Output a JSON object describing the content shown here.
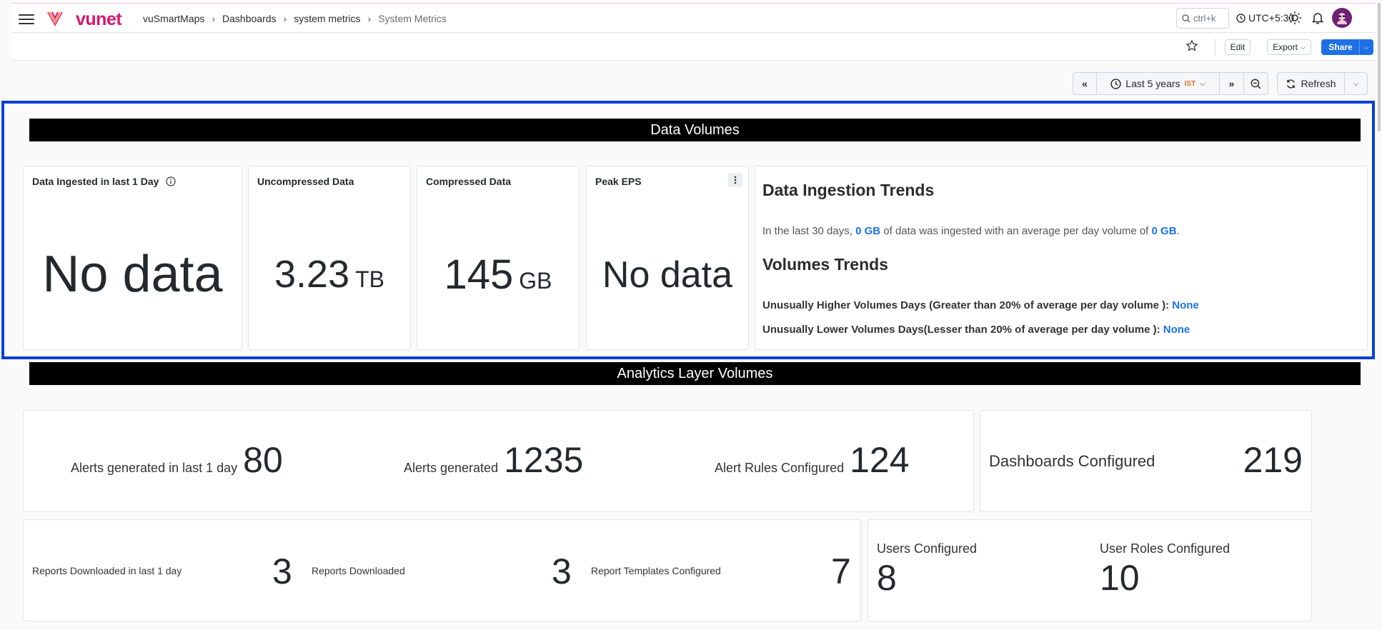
{
  "header": {
    "brand": "vunet",
    "breadcrumbs": [
      "vuSmartMaps",
      "Dashboards",
      "system metrics",
      "System Metrics"
    ],
    "search_label": "ctrl+k",
    "timezone": "UTC+5:30"
  },
  "toolbar": {
    "edit_label": "Edit",
    "export_label": "Export",
    "share_label": "Share"
  },
  "timebar": {
    "range_label": "Last 5 years",
    "tz_badge": "IST",
    "refresh_label": "Refresh"
  },
  "sections": {
    "data_volumes_title": "Data Volumes",
    "analytics_title": "Analytics Layer Volumes"
  },
  "data_panels": {
    "ingested": {
      "title": "Data Ingested in last 1 Day",
      "value": "No data"
    },
    "uncompressed": {
      "title": "Uncompressed Data",
      "value": "3.23",
      "unit": "TB"
    },
    "compressed": {
      "title": "Compressed Data",
      "value": "145",
      "unit": "GB"
    },
    "peak_eps": {
      "title": "Peak EPS",
      "value": "No data"
    }
  },
  "trends": {
    "ingestion_heading": "Data Ingestion Trends",
    "ingestion_prefix": "In the last 30 days,",
    "ingestion_value1": "0 GB",
    "ingestion_middle": "of data was ingested with an average per day volume of",
    "ingestion_value2": "0 GB",
    "ingestion_suffix": ".",
    "volumes_heading": "Volumes Trends",
    "higher_label": "Unusually Higher Volumes Days (Greater than 20% of average per day volume ):",
    "higher_value": "None",
    "lower_label": "Unusually Lower Volumes Days(Lesser than 20% of average per day volume ):",
    "lower_value": "None"
  },
  "analytics": {
    "alerts_1day_label": "Alerts generated in last 1 day",
    "alerts_1day_value": "80",
    "alerts_label": "Alerts generated",
    "alerts_value": "1235",
    "alert_rules_label": "Alert Rules Configured",
    "alert_rules_value": "124",
    "dashboards_label": "Dashboards Configured",
    "dashboards_value": "219",
    "reports_1day_label": "Reports Downloaded in last 1 day",
    "reports_1day_value": "3",
    "reports_label": "Reports Downloaded",
    "reports_value": "3",
    "report_templates_label": "Report Templates Configured",
    "report_templates_value": "7",
    "users_label": "Users Configured",
    "users_value": "8",
    "user_roles_label": "User Roles Configured",
    "user_roles_value": "10"
  },
  "colors": {
    "brand": "#d6176b",
    "accent": "#1f6fe5",
    "highlight": "#0a3fd6",
    "link_value": "#1a72e8"
  }
}
